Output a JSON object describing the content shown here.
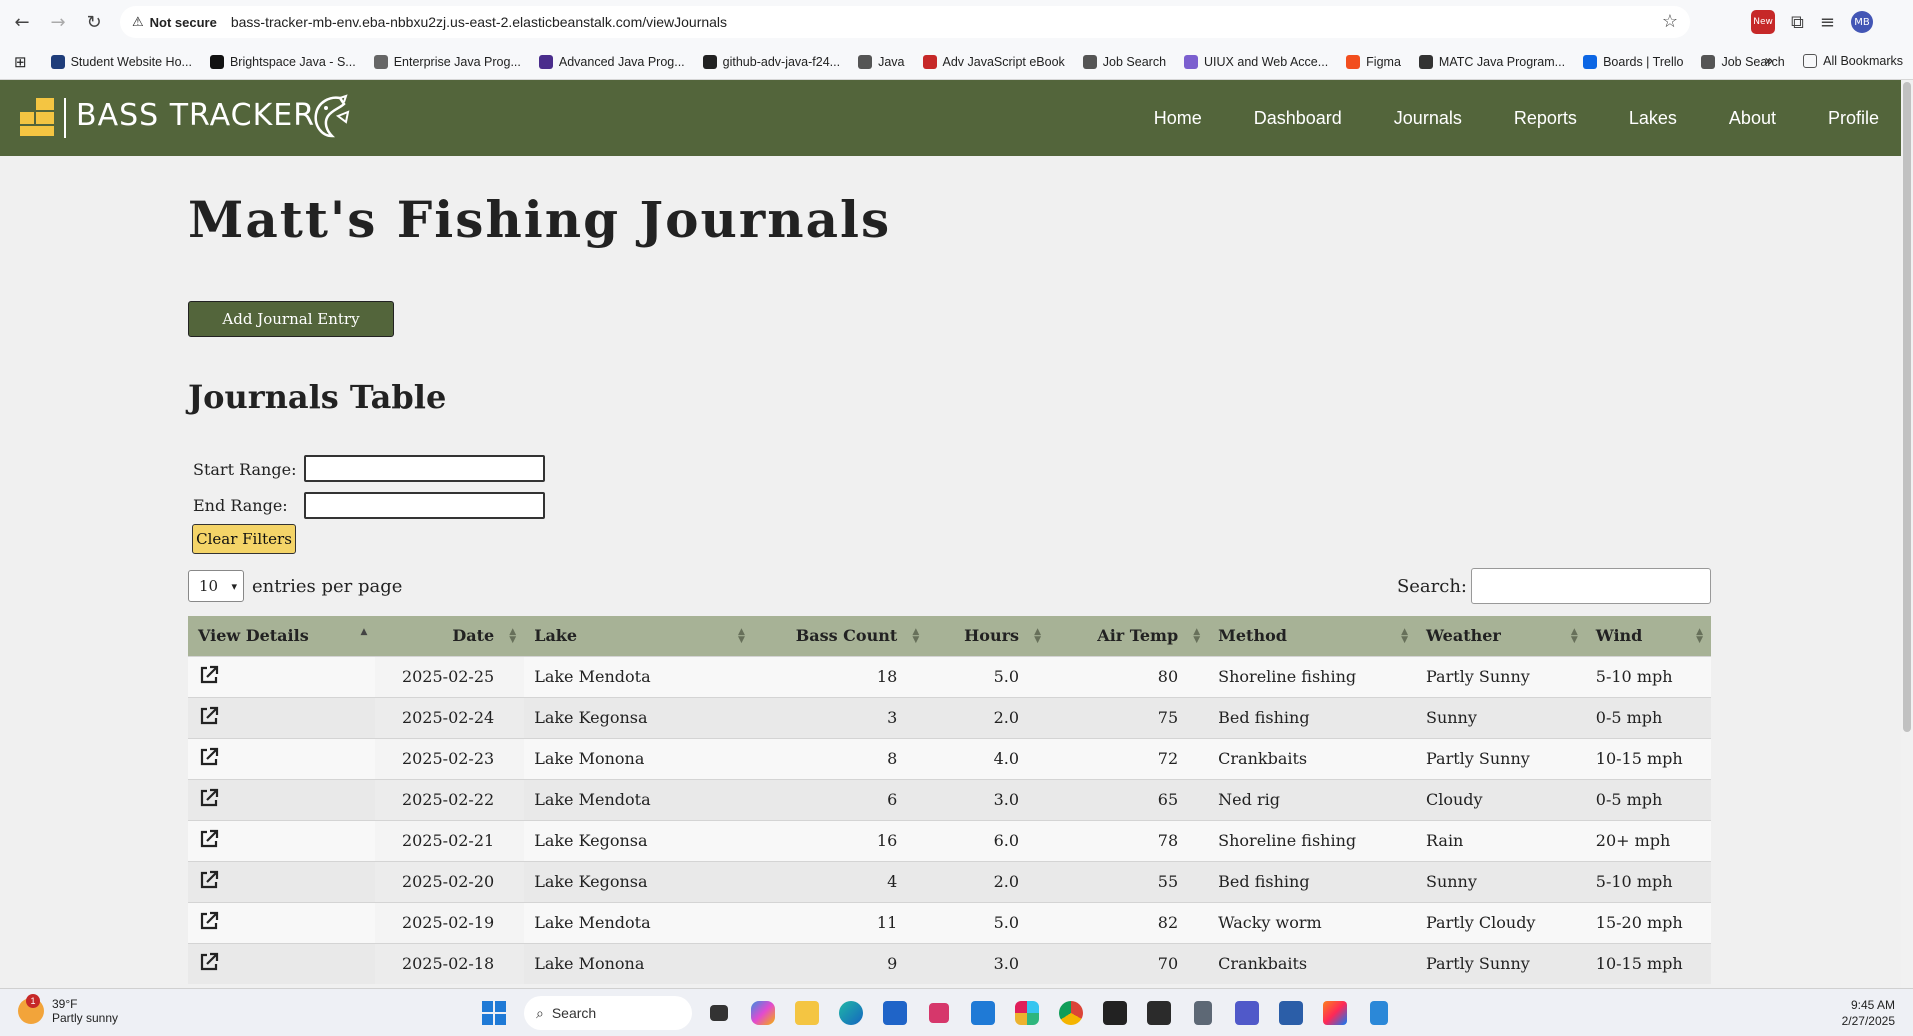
{
  "browser": {
    "security_label": "Not secure",
    "url": "bass-tracker-mb-env.eba-nbbxu2zj.us-east-2.elasticbeanstalk.com/viewJournals",
    "profile_initials": "MB",
    "extension_badge": "New"
  },
  "bookmarks": [
    {
      "label": "Student Website Ho...",
      "color": "#1f3d7a"
    },
    {
      "label": "Brightspace Java - S...",
      "color": "#111111"
    },
    {
      "label": "Enterprise Java Prog...",
      "color": "#666666"
    },
    {
      "label": "Advanced Java Prog...",
      "color": "#4a2d8c"
    },
    {
      "label": "github-adv-java-f24...",
      "color": "#222222"
    },
    {
      "label": "Java",
      "color": "#555555"
    },
    {
      "label": "Adv JavaScript eBook",
      "color": "#c62828"
    },
    {
      "label": "Job Search",
      "color": "#555555"
    },
    {
      "label": "UIUX and Web Acce...",
      "color": "#7b5fcf"
    },
    {
      "label": "Figma",
      "color": "#f24e1e"
    },
    {
      "label": "MATC Java Program...",
      "color": "#333333"
    },
    {
      "label": "Boards | Trello",
      "color": "#0c66e4"
    },
    {
      "label": "Job Search",
      "color": "#555555"
    }
  ],
  "bookmarks_all": "All Bookmarks",
  "site": {
    "brand": "BASS TRACKER",
    "nav": [
      "Home",
      "Dashboard",
      "Journals",
      "Reports",
      "Lakes",
      "About",
      "Profile"
    ]
  },
  "page": {
    "title": "Matt's Fishing Journals",
    "add_button": "Add Journal Entry",
    "section_title": "Journals Table",
    "start_range_label": "Start Range:",
    "end_range_label": "End Range:",
    "clear_button": "Clear Filters",
    "entries_value": "10",
    "entries_label": "entries per page",
    "search_label": "Search:"
  },
  "table": {
    "columns": [
      "View Details",
      "Date",
      "Lake",
      "Bass Count",
      "Hours",
      "Air Temp",
      "Method",
      "Weather",
      "Wind"
    ],
    "rows": [
      [
        "2025-02-25",
        "Lake Mendota",
        "18",
        "5.0",
        "80",
        "Shoreline fishing",
        "Partly Sunny",
        "5-10 mph"
      ],
      [
        "2025-02-24",
        "Lake Kegonsa",
        "3",
        "2.0",
        "75",
        "Bed fishing",
        "Sunny",
        "0-5 mph"
      ],
      [
        "2025-02-23",
        "Lake Monona",
        "8",
        "4.0",
        "72",
        "Crankbaits",
        "Partly Sunny",
        "10-15 mph"
      ],
      [
        "2025-02-22",
        "Lake Mendota",
        "6",
        "3.0",
        "65",
        "Ned rig",
        "Cloudy",
        "0-5 mph"
      ],
      [
        "2025-02-21",
        "Lake Kegonsa",
        "16",
        "6.0",
        "78",
        "Shoreline fishing",
        "Rain",
        "20+ mph"
      ],
      [
        "2025-02-20",
        "Lake Kegonsa",
        "4",
        "2.0",
        "55",
        "Bed fishing",
        "Sunny",
        "5-10 mph"
      ],
      [
        "2025-02-19",
        "Lake Mendota",
        "11",
        "5.0",
        "82",
        "Wacky worm",
        "Partly Cloudy",
        "15-20 mph"
      ],
      [
        "2025-02-18",
        "Lake Monona",
        "9",
        "3.0",
        "70",
        "Crankbaits",
        "Partly Sunny",
        "10-15 mph"
      ]
    ]
  },
  "taskbar": {
    "temp": "39°F",
    "condition": "Partly sunny",
    "weather_badge": "1",
    "search_placeholder": "Search",
    "time": "9:45 AM",
    "date": "2/27/2025"
  },
  "colors": {
    "header_green": "#53653b",
    "table_header": "#a7b296",
    "logo_yellow": "#f4c542",
    "clear_button": "#f4d468"
  }
}
